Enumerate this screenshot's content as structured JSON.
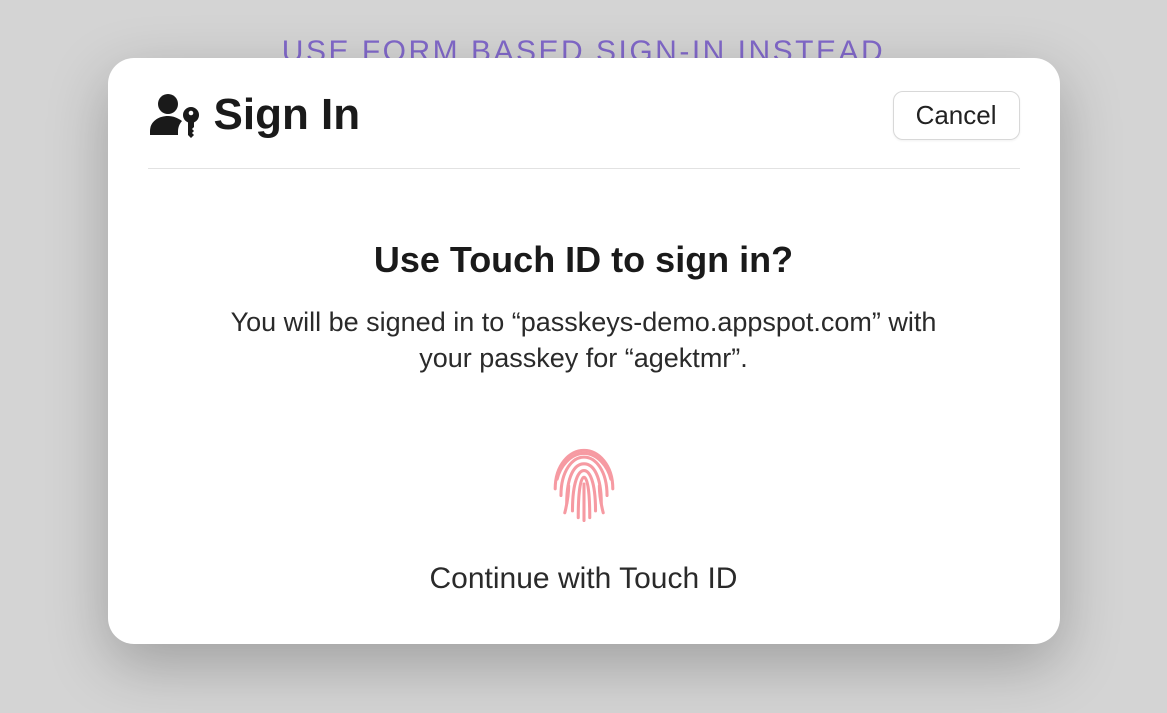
{
  "background_link": "USE FORM BASED SIGN-IN INSTEAD",
  "dialog": {
    "title": "Sign In",
    "cancel_label": "Cancel",
    "heading": "Use Touch ID to sign in?",
    "description": "You will be signed in to “passkeys-demo.appspot.com” with your passkey for “agektmr”.",
    "continue_label": "Continue with Touch ID"
  },
  "colors": {
    "link": "#8168c9",
    "fingerprint": "#f69aa2"
  }
}
